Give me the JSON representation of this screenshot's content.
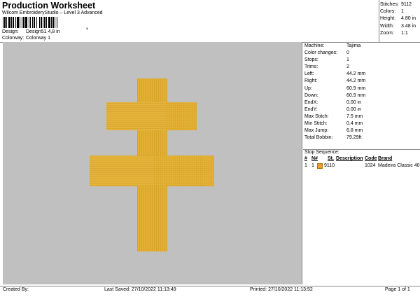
{
  "header": {
    "title": "Production Worksheet",
    "software": "Wilcom EmbroideryStudio – Level 3 Advanced",
    "barcode_suffix": ",",
    "design_label": "Design:",
    "design_value": "Design51 4,8 in",
    "colorway_label": "Colorway:",
    "colorway_value": "Colorway 1"
  },
  "stats": [
    {
      "label": "Stitches:",
      "value": "9112"
    },
    {
      "label": "Colors:",
      "value": "1"
    },
    {
      "label": "Height:",
      "value": "4.80 in"
    },
    {
      "label": "Width:",
      "value": "3.48 in"
    },
    {
      "label": "Zoom:",
      "value": "1:1"
    }
  ],
  "machine_info": [
    {
      "label": "Machine:",
      "value": "Tajima"
    },
    {
      "label": "Color changes:",
      "value": "0"
    },
    {
      "label": "Stops:",
      "value": "1"
    },
    {
      "label": "Trims:",
      "value": "2"
    },
    {
      "label": "Left:",
      "value": "44.2 mm"
    },
    {
      "label": "Right:",
      "value": "44.2 mm"
    },
    {
      "label": "Up:",
      "value": "60.9 mm"
    },
    {
      "label": "Down:",
      "value": "60.9 mm"
    },
    {
      "label": "EndX:",
      "value": "0.00 in"
    },
    {
      "label": "EndY:",
      "value": "0.00 in"
    },
    {
      "label": "Max Stitch:",
      "value": "7.5 mm"
    },
    {
      "label": "Min Stitch:",
      "value": "0.4 mm"
    },
    {
      "label": "Max Jump:",
      "value": "6.8 mm"
    },
    {
      "label": "Total Bobbin:",
      "value": "79.29ft"
    }
  ],
  "stop_sequence": {
    "title": "Stop Sequence:",
    "columns": [
      "#",
      "N#",
      "St.",
      "Description",
      "Code",
      "Brand"
    ],
    "rows": [
      {
        "num": "1",
        "n": "1",
        "color": "#e6a128",
        "st": "9110",
        "description": "",
        "code": "1024",
        "brand": "Madeira Classic 40"
      }
    ]
  },
  "footer": {
    "created_by": "Created By:",
    "last_saved": "Last Saved: 27/10/2022 11:13:49",
    "printed": "Printed: 27/10/2022 11:13:52",
    "page": "Page 1 of 1"
  },
  "colors": {
    "canvas_bg": "#c0c0c0",
    "thread": "#e2b033"
  }
}
